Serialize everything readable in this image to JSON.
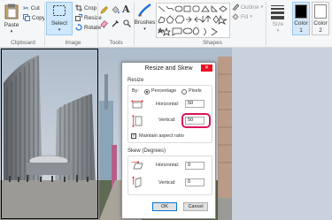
{
  "ribbon": {
    "clipboard": {
      "paste": "Paste",
      "cut": "Cut",
      "copy": "Copy",
      "label": "Clipboard"
    },
    "image": {
      "select": "Select",
      "crop": "Crop",
      "resize": "Resize",
      "rotate": "Rotate",
      "label": "Image"
    },
    "tools": {
      "label": "Tools"
    },
    "brushes": {
      "label": "Brushes"
    },
    "shapes": {
      "outline": "Outline",
      "fill": "Fill",
      "label": "Shapes"
    },
    "size": {
      "label": "Size"
    },
    "colors": {
      "color1": {
        "label": "Color",
        "num": "1",
        "hex": "#000000"
      },
      "color2": {
        "label": "Color",
        "num": "2",
        "hex": "#ffffff"
      }
    }
  },
  "dialog": {
    "title": "Resize and Skew",
    "close_icon": "close-icon",
    "resize": {
      "section": "Resize",
      "by_label": "By:",
      "option_percentage": "Percentage",
      "option_pixels": "Pixels",
      "horizontal_label": "Horizontal:",
      "horizontal_value": "50",
      "vertical_label": "Vertical:",
      "vertical_value": "50",
      "maintain_aspect": "Maintain aspect ratio"
    },
    "skew": {
      "section": "Skew (Degrees)",
      "horizontal_label": "Horizontal:",
      "horizontal_value": "0",
      "vertical_label": "Vertical:",
      "vertical_value": "0"
    },
    "ok": "OK",
    "cancel": "Cancel"
  },
  "colors": {
    "highlight": "#d9155b",
    "select_bg": "#cde8ff",
    "close_bg": "#e81123"
  }
}
